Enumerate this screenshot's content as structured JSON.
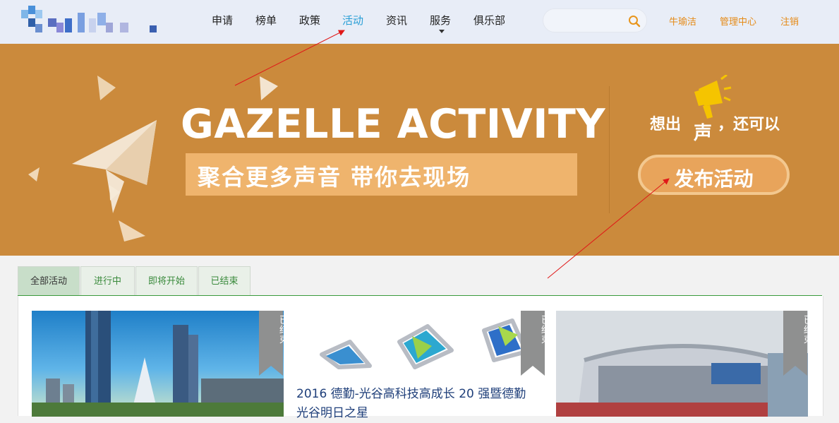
{
  "nav": {
    "items": [
      {
        "label": "申请"
      },
      {
        "label": "榜单"
      },
      {
        "label": "政策"
      },
      {
        "label": "活动"
      },
      {
        "label": "资讯"
      },
      {
        "label": "服务"
      },
      {
        "label": "俱乐部"
      }
    ],
    "active_item": "活动",
    "search": {
      "value": "",
      "placeholder": ""
    },
    "user": {
      "name": "牛瑜洁",
      "admin_label": "管理中心",
      "logout_label": "注销"
    }
  },
  "banner": {
    "title": "GAZELLE ACTIVITY",
    "subtitle": "聚合更多声音  带你去现场",
    "voice_prefix": "想出",
    "voice_word": "声",
    "voice_suffix": "，还可以",
    "publish_button": "发布活动"
  },
  "tabs": [
    {
      "label": "全部活动",
      "active": true
    },
    {
      "label": "进行中",
      "active": false
    },
    {
      "label": "即将开始",
      "active": false
    },
    {
      "label": "已结束",
      "active": false
    }
  ],
  "activities": [
    {
      "status": "已结束",
      "title": "",
      "image": "city-skyline-image"
    },
    {
      "status": "已结束",
      "title": "2016 德勤-光谷高科技高成长 20 强暨德勤 光谷明日之星",
      "image": "magnetic-triangle-toys-image"
    },
    {
      "status": "已结束",
      "title": "",
      "image": "convention-center-image"
    }
  ],
  "colors": {
    "banner_bg": "#cb8a3c",
    "nav_active": "#2a9fd6",
    "user_link": "#e58a16",
    "tab_accent": "#3a9a3c",
    "badge": "#8f9090"
  }
}
